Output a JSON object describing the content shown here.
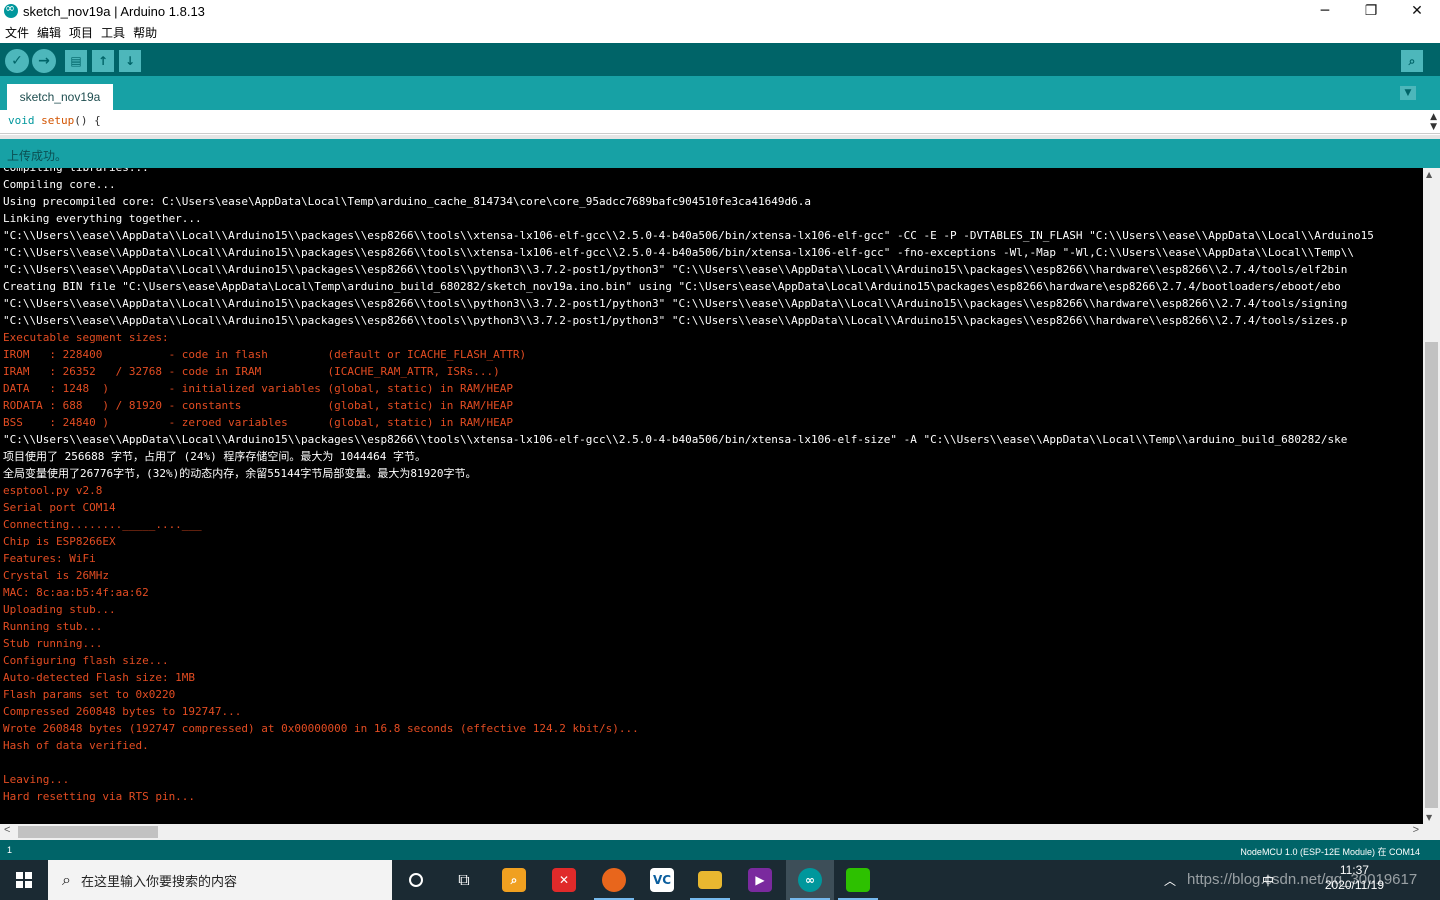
{
  "window": {
    "title": "sketch_nov19a | Arduino 1.8.13",
    "controls": {
      "minimize": "─",
      "maximize": "❐",
      "close": "✕"
    }
  },
  "menu": [
    "文件",
    "编辑",
    "项目",
    "工具",
    "帮助"
  ],
  "toolbar": {
    "verify_icon": "✓",
    "upload_icon": "→",
    "new_icon": "▤",
    "open_icon": "↑",
    "save_icon": "↓",
    "serial_monitor_icon": "⌕"
  },
  "tab": {
    "label": "sketch_nov19a",
    "menu_icon": "▼"
  },
  "editor": {
    "keyword": "void",
    "function": "setup",
    "rest": "() {"
  },
  "status": {
    "message": "上传成功。"
  },
  "console": {
    "lines": [
      {
        "text": "Compiling libraries...",
        "color": "white"
      },
      {
        "text": "Compiling core...",
        "color": "white"
      },
      {
        "text": "Using precompiled core: C:\\Users\\ease\\AppData\\Local\\Temp\\arduino_cache_814734\\core\\core_95adcc7689bafc904510fe3ca41649d6.a",
        "color": "white"
      },
      {
        "text": "Linking everything together...",
        "color": "white"
      },
      {
        "text": "\"C:\\\\Users\\\\ease\\\\AppData\\\\Local\\\\Arduino15\\\\packages\\\\esp8266\\\\tools\\\\xtensa-lx106-elf-gcc\\\\2.5.0-4-b40a506/bin/xtensa-lx106-elf-gcc\" -CC -E -P -DVTABLES_IN_FLASH \"C:\\\\Users\\\\ease\\\\AppData\\\\Local\\\\Arduino15",
        "color": "white"
      },
      {
        "text": "\"C:\\\\Users\\\\ease\\\\AppData\\\\Local\\\\Arduino15\\\\packages\\\\esp8266\\\\tools\\\\xtensa-lx106-elf-gcc\\\\2.5.0-4-b40a506/bin/xtensa-lx106-elf-gcc\" -fno-exceptions -Wl,-Map \"-Wl,C:\\\\Users\\\\ease\\\\AppData\\\\Local\\\\Temp\\\\",
        "color": "white"
      },
      {
        "text": "\"C:\\\\Users\\\\ease\\\\AppData\\\\Local\\\\Arduino15\\\\packages\\\\esp8266\\\\tools\\\\python3\\\\3.7.2-post1/python3\" \"C:\\\\Users\\\\ease\\\\AppData\\\\Local\\\\Arduino15\\\\packages\\\\esp8266\\\\hardware\\\\esp8266\\\\2.7.4/tools/elf2bin",
        "color": "white"
      },
      {
        "text": "Creating BIN file \"C:\\Users\\ease\\AppData\\Local\\Temp\\arduino_build_680282/sketch_nov19a.ino.bin\" using \"C:\\Users\\ease\\AppData\\Local\\Arduino15\\packages\\esp8266\\hardware\\esp8266\\2.7.4/bootloaders/eboot/ebo",
        "color": "white"
      },
      {
        "text": "\"C:\\\\Users\\\\ease\\\\AppData\\\\Local\\\\Arduino15\\\\packages\\\\esp8266\\\\tools\\\\python3\\\\3.7.2-post1/python3\" \"C:\\\\Users\\\\ease\\\\AppData\\\\Local\\\\Arduino15\\\\packages\\\\esp8266\\\\hardware\\\\esp8266\\\\2.7.4/tools/signing",
        "color": "white"
      },
      {
        "text": "\"C:\\\\Users\\\\ease\\\\AppData\\\\Local\\\\Arduino15\\\\packages\\\\esp8266\\\\tools\\\\python3\\\\3.7.2-post1/python3\" \"C:\\\\Users\\\\ease\\\\AppData\\\\Local\\\\Arduino15\\\\packages\\\\esp8266\\\\hardware\\\\esp8266\\\\2.7.4/tools/sizes.p",
        "color": "white"
      },
      {
        "text": "Executable segment sizes:",
        "color": "orange"
      },
      {
        "text": "IROM   : 228400          - code in flash         (default or ICACHE_FLASH_ATTR)",
        "color": "orange"
      },
      {
        "text": "IRAM   : 26352   / 32768 - code in IRAM          (ICACHE_RAM_ATTR, ISRs...)",
        "color": "orange"
      },
      {
        "text": "DATA   : 1248  )         - initialized variables (global, static) in RAM/HEAP",
        "color": "orange"
      },
      {
        "text": "RODATA : 688   ) / 81920 - constants             (global, static) in RAM/HEAP",
        "color": "orange"
      },
      {
        "text": "BSS    : 24840 )         - zeroed variables      (global, static) in RAM/HEAP",
        "color": "orange"
      },
      {
        "text": "\"C:\\\\Users\\\\ease\\\\AppData\\\\Local\\\\Arduino15\\\\packages\\\\esp8266\\\\tools\\\\xtensa-lx106-elf-gcc\\\\2.5.0-4-b40a506/bin/xtensa-lx106-elf-size\" -A \"C:\\\\Users\\\\ease\\\\AppData\\\\Local\\\\Temp\\\\arduino_build_680282/ske",
        "color": "white"
      },
      {
        "text": "项目使用了 256688 字节，占用了 (24%) 程序存储空间。最大为 1044464 字节。",
        "color": "white"
      },
      {
        "text": "全局变量使用了26776字节，(32%)的动态内存，余留55144字节局部变量。最大为81920字节。",
        "color": "white"
      },
      {
        "text": "esptool.py v2.8",
        "color": "orange"
      },
      {
        "text": "Serial port COM14",
        "color": "orange"
      },
      {
        "text": "Connecting........_____....___",
        "color": "orange"
      },
      {
        "text": "Chip is ESP8266EX",
        "color": "orange"
      },
      {
        "text": "Features: WiFi",
        "color": "orange"
      },
      {
        "text": "Crystal is 26MHz",
        "color": "orange"
      },
      {
        "text": "MAC: 8c:aa:b5:4f:aa:62",
        "color": "orange"
      },
      {
        "text": "Uploading stub...",
        "color": "orange"
      },
      {
        "text": "Running stub...",
        "color": "orange"
      },
      {
        "text": "Stub running...",
        "color": "orange"
      },
      {
        "text": "Configuring flash size...",
        "color": "orange"
      },
      {
        "text": "Auto-detected Flash size: 1MB",
        "color": "orange"
      },
      {
        "text": "Flash params set to 0x0220",
        "color": "orange"
      },
      {
        "text": "Compressed 260848 bytes to 192747...",
        "color": "orange"
      },
      {
        "text": "Wrote 260848 bytes (192747 compressed) at 0x00000000 in 16.8 seconds (effective 124.2 kbit/s)...",
        "color": "orange"
      },
      {
        "text": "Hash of data verified.",
        "color": "orange"
      },
      {
        "text": "",
        "color": "orange"
      },
      {
        "text": "Leaving...",
        "color": "orange"
      },
      {
        "text": "Hard resetting via RTS pin...",
        "color": "orange"
      }
    ]
  },
  "footer": {
    "line_number": "1",
    "board": "NodeMCU 1.0 (ESP-12E Module) 在 COM14"
  },
  "taskbar": {
    "search_placeholder": "在这里输入你要搜索的内容",
    "clock_time": "11:37",
    "clock_date": "2020/11/19",
    "tray_ime": "中",
    "watermark": "https://blog.csdn.net/qq_30019617"
  },
  "colors": {
    "teal_dark": "#006468",
    "teal": "#17a1a5",
    "console_orange": "#e34c22"
  }
}
